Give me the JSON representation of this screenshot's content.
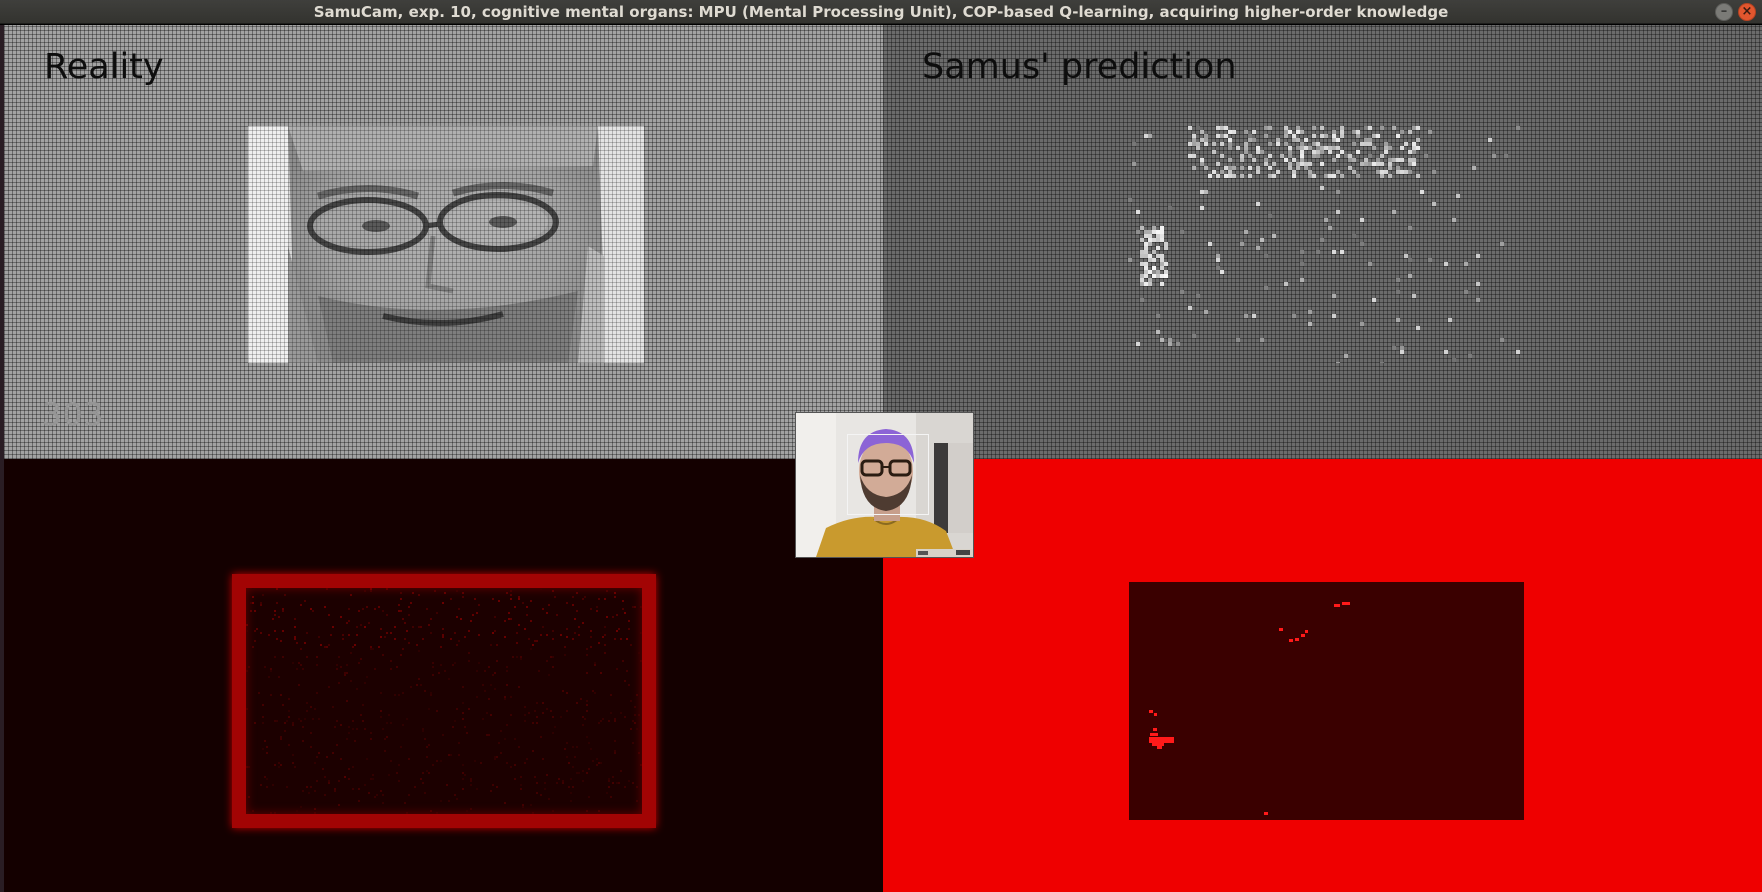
{
  "window": {
    "title": "SamuCam, exp. 10, cognitive mental organs: MPU (Mental Processing Unit), COP-based Q-learning, acquiring higher-order knowledge",
    "controls": {
      "minimize_icon": "minimize-icon",
      "close_icon": "close-icon"
    }
  },
  "panels": {
    "reality": {
      "label": "Reality",
      "counter": "303",
      "background": "#a2a2a2"
    },
    "prediction": {
      "label": "Samus' prediction",
      "background": "#6b6b6b"
    },
    "bottom_left": {
      "background": "#140000",
      "frame_color": "#a20404"
    },
    "bottom_right": {
      "background": "#ef0000",
      "inner_color": "#3a0000"
    }
  },
  "webcam": {
    "subject": "webcam-thumbnail",
    "face_detection_box": true
  }
}
